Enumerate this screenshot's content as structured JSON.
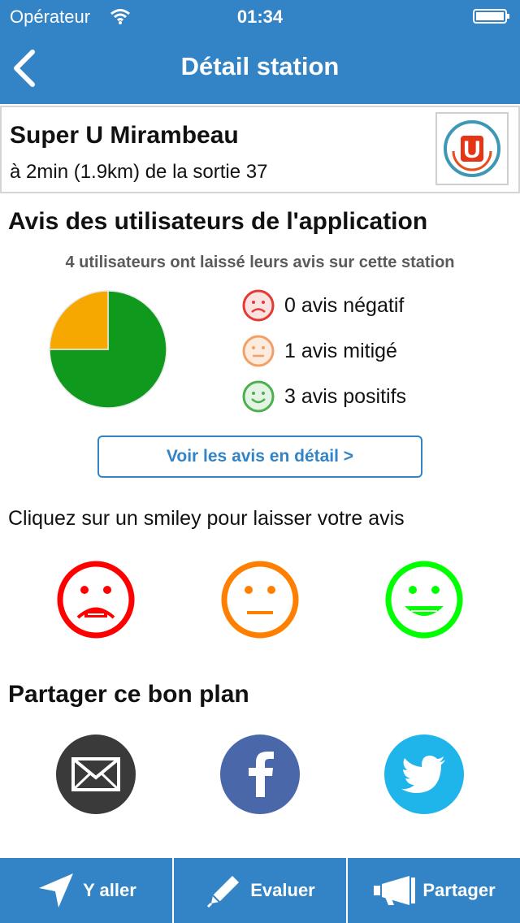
{
  "status_bar": {
    "carrier": "Opérateur",
    "time": "01:34",
    "icons": [
      "wifi-icon",
      "battery-icon"
    ]
  },
  "nav": {
    "title": "Détail station",
    "back_icon": "chevron-left-icon"
  },
  "station": {
    "name": "Super U Mirambeau",
    "distance": "à 2min (1.9km) de la sortie 37",
    "logo_letter": "U"
  },
  "reviews": {
    "title": "Avis des utilisateurs de l'application",
    "count_text": "4 utilisateurs ont laissé leurs avis sur cette station",
    "legend": [
      {
        "label": "0 avis négatif",
        "color": "#e53935",
        "icon": "sad-face-icon"
      },
      {
        "label": "1 avis mitigé",
        "color": "#f3a068",
        "icon": "neutral-face-icon"
      },
      {
        "label": "3 avis positifs",
        "color": "#4caf50",
        "icon": "happy-face-icon"
      }
    ],
    "detail_button": "Voir les avis en détail >"
  },
  "chart_data": {
    "type": "pie",
    "categories": [
      "négatif",
      "mitigé",
      "positifs"
    ],
    "values": [
      0,
      1,
      3
    ],
    "colors": [
      "#e53935",
      "#f7a800",
      "#0f9a1e"
    ]
  },
  "rate": {
    "prompt": "Cliquez sur un smiley pour laisser votre avis",
    "options": [
      {
        "name": "sad-smiley-button",
        "color": "#ff0000"
      },
      {
        "name": "neutral-smiley-button",
        "color": "#ff8000"
      },
      {
        "name": "happy-smiley-button",
        "color": "#00ff00"
      }
    ]
  },
  "share": {
    "title": "Partager ce bon plan",
    "buttons": [
      {
        "name": "email-share-button",
        "icon": "envelope-icon",
        "color": "#3a3a3a"
      },
      {
        "name": "facebook-share-button",
        "icon": "facebook-icon",
        "color": "#4a67a9"
      },
      {
        "name": "twitter-share-button",
        "icon": "twitter-bird-icon",
        "color": "#1fb4ea"
      }
    ]
  },
  "toolbar": {
    "go_label": "Y aller",
    "rate_label": "Evaluer",
    "share_label": "Partager"
  },
  "colors": {
    "primary": "#3384c6"
  }
}
